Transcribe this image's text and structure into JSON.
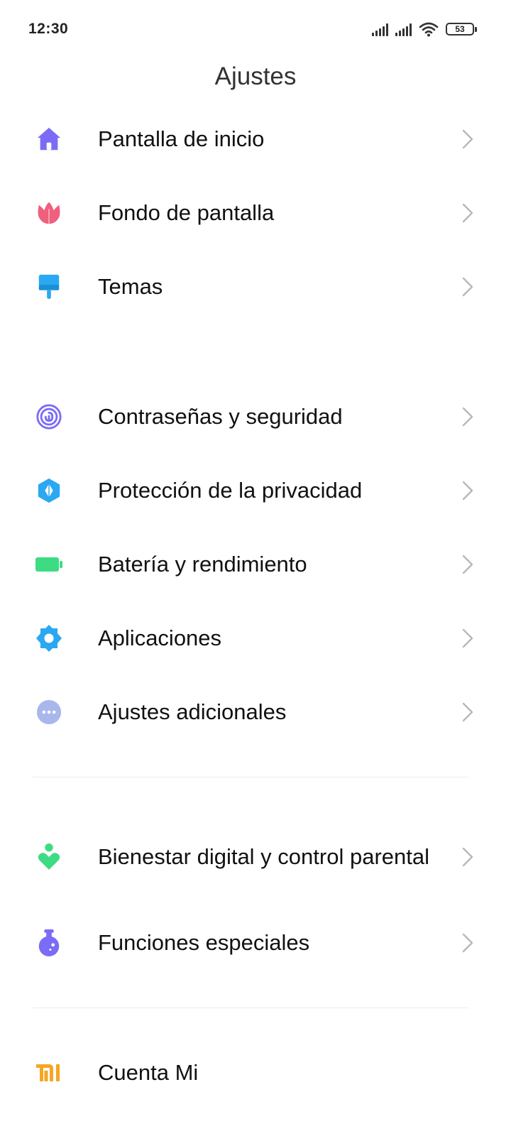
{
  "status_bar": {
    "time": "12:30",
    "battery_level": "53",
    "icons": [
      "signal-icon",
      "signal-icon",
      "wifi-icon",
      "battery-icon"
    ]
  },
  "page": {
    "title": "Ajustes"
  },
  "groups": [
    {
      "items": [
        {
          "label": "Pantalla de inicio",
          "icon": "home-icon",
          "icon_color": "#7b6cf6"
        },
        {
          "label": "Fondo de pantalla",
          "icon": "tulip-icon",
          "icon_color": "#f0607e"
        },
        {
          "label": "Temas",
          "icon": "paint-brush-icon",
          "icon_color": "#2aa8f2"
        }
      ]
    },
    {
      "items": [
        {
          "label": "Contraseñas y seguridad",
          "icon": "fingerprint-icon",
          "icon_color": "#7b6cf6"
        },
        {
          "label": "Protección de la privacidad",
          "icon": "privacy-shield-icon",
          "icon_color": "#2aa8f2"
        },
        {
          "label": "Batería y rendimiento",
          "icon": "battery-icon",
          "icon_color": "#3ddc84"
        },
        {
          "label": "Aplicaciones",
          "icon": "gear-icon",
          "icon_color": "#2aa8f2"
        },
        {
          "label": "Ajustes adicionales",
          "icon": "more-dots-icon",
          "icon_color": "#a8b8ec"
        }
      ]
    },
    {
      "items": [
        {
          "label": "Bienestar digital y control parental",
          "icon": "wellbeing-heart-icon",
          "icon_color": "#3ddc84"
        },
        {
          "label": "Funciones especiales",
          "icon": "flask-icon",
          "icon_color": "#7b6cf6"
        }
      ]
    },
    {
      "items": [
        {
          "label": "Cuenta Mi",
          "icon": "mi-logo-icon",
          "icon_color": "#f5a623"
        }
      ]
    }
  ],
  "chevron_color": "#b8b8b8"
}
